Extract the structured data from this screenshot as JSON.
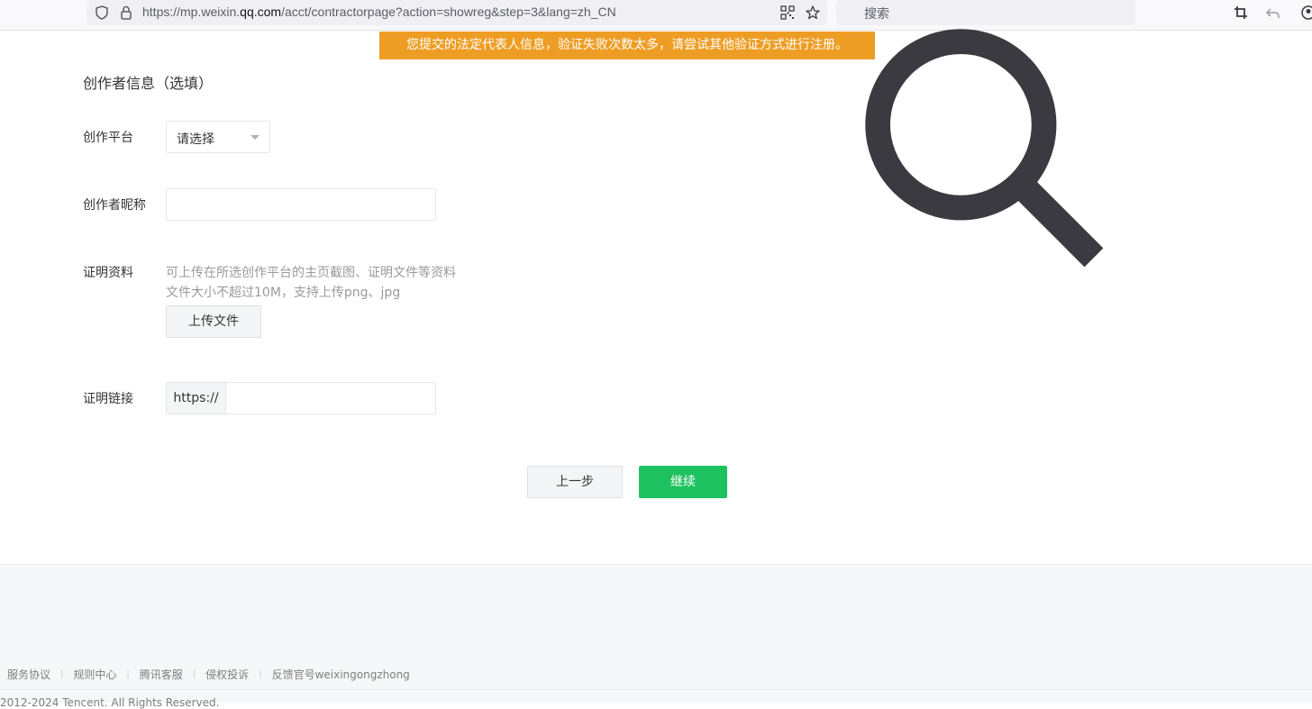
{
  "browser": {
    "url_prefix": "https://mp.weixin.",
    "url_host": "qq.com",
    "url_suffix": "/acct/contractorpage?action=showreg&step=3&lang=zh_CN",
    "search_placeholder": "搜索"
  },
  "alert": {
    "text": "您提交的法定代表人信息，验证失败次数太多，请尝试其他验证方式进行注册。",
    "color": "#ee9d24"
  },
  "form": {
    "section_title": "创作者信息（选填）",
    "platform": {
      "label": "创作平台",
      "value": "请选择"
    },
    "nickname": {
      "label": "创作者昵称",
      "value": ""
    },
    "proof": {
      "label": "证明资料",
      "hint_line1": "可上传在所选创作平台的主页截图、证明文件等资料",
      "hint_line2": "文件大小不超过10M，支持上传png、jpg",
      "upload_label": "上传文件"
    },
    "link": {
      "label": "证明链接",
      "prefix": "https://",
      "value": ""
    }
  },
  "actions": {
    "prev_label": "上一步",
    "next_label": "继续",
    "next_color": "#1ec15f"
  },
  "footer": {
    "links": [
      "服务协议",
      "规则中心",
      "腾讯客服",
      "侵权投诉",
      "反馈官号weixingongzhong"
    ],
    "copyright": "2012-2024 Tencent. All Rights Reserved."
  }
}
